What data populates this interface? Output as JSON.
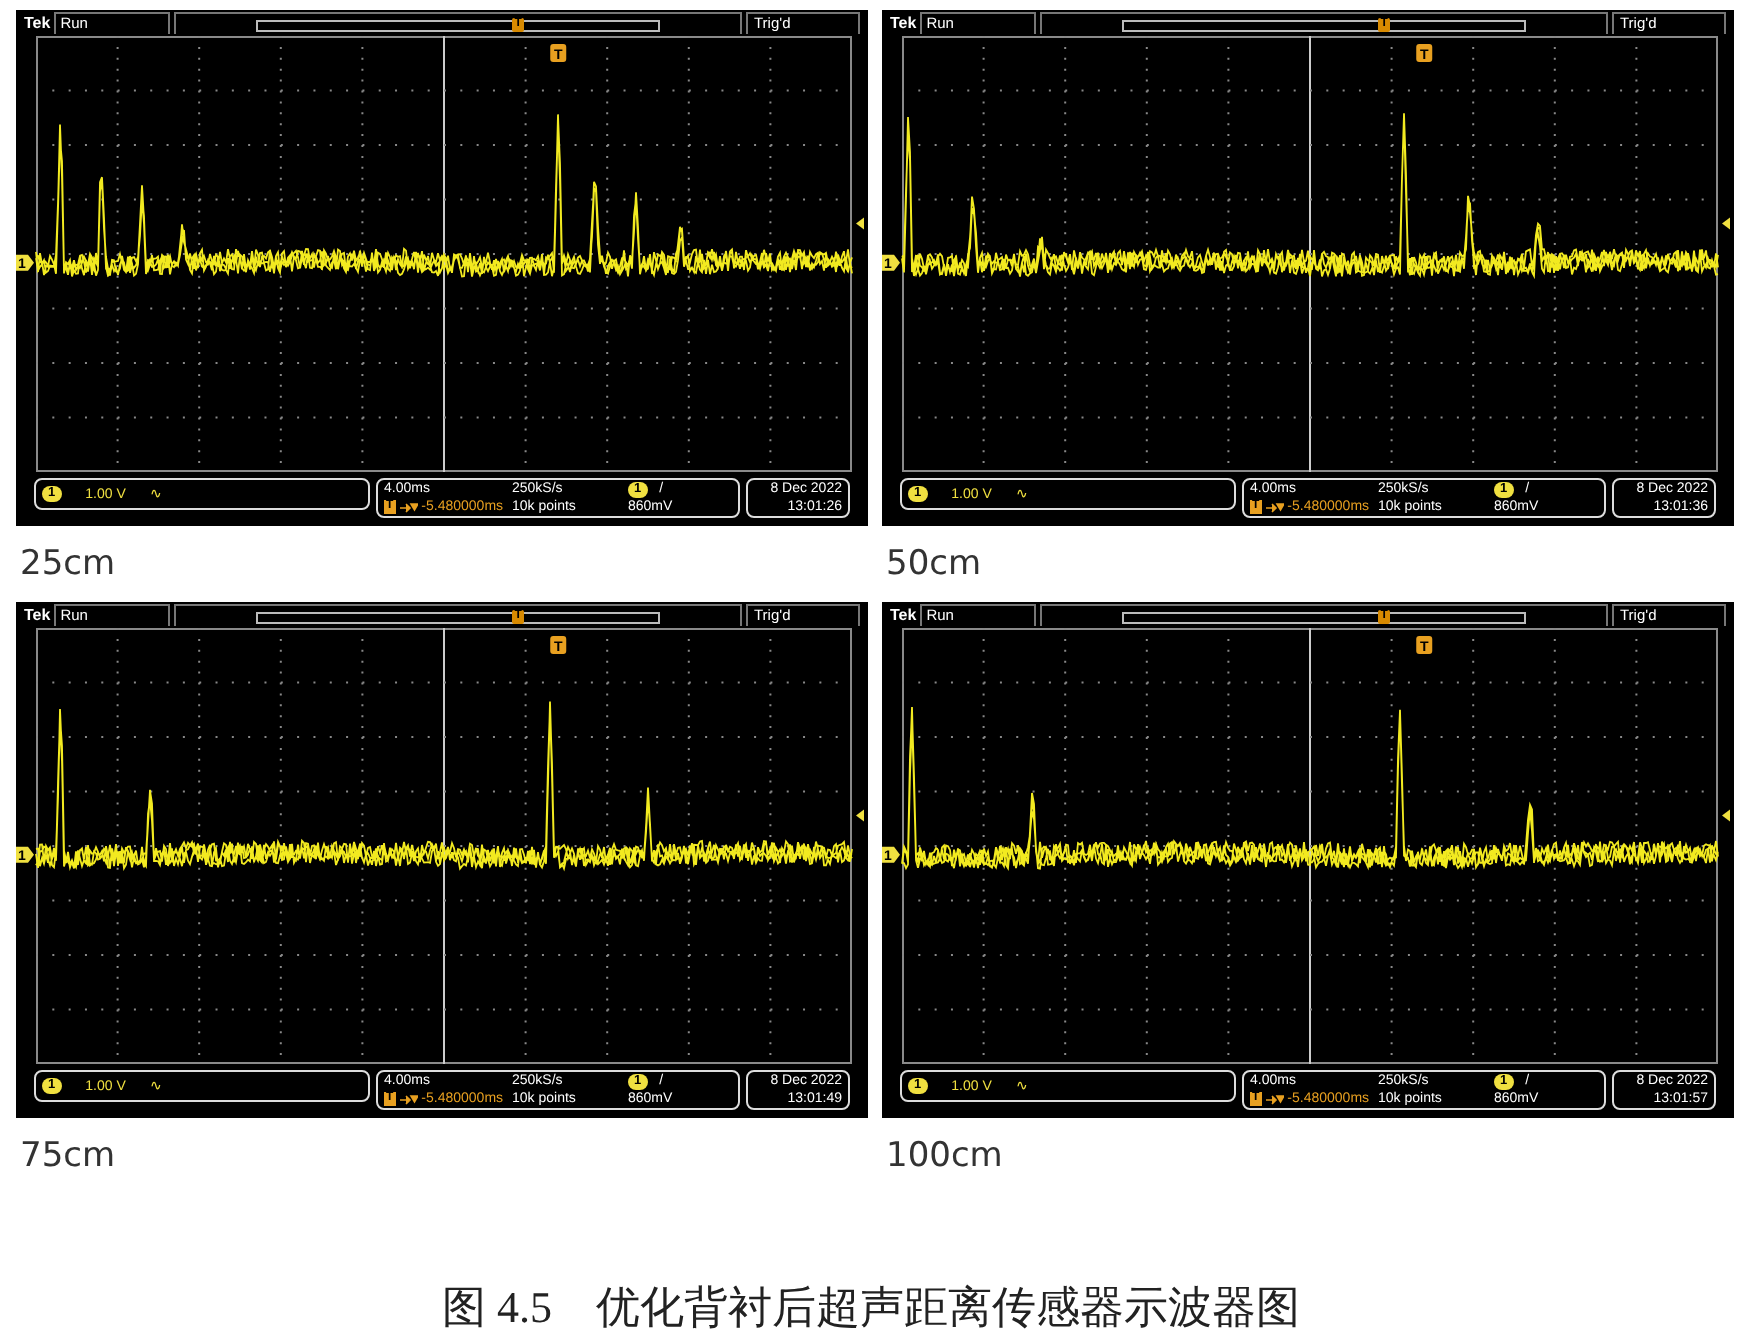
{
  "figure": {
    "panels": [
      {
        "label": "25cm",
        "scope": {
          "brand": "Tek",
          "run_state": "Run",
          "trigger_state": "Trig'd",
          "trigger_marker": "T",
          "channel_marker": "1",
          "channel": {
            "number": "1",
            "scale": "1.00 V",
            "coupling": "∿"
          },
          "timebase": {
            "scale": "4.00ms",
            "sample_rate": "250kS/s",
            "trigger_badge": "T",
            "delay": "-5.480000ms",
            "record_length": "10k points"
          },
          "trigger": {
            "source": "1",
            "slope": "/",
            "threshold": "860mV"
          },
          "date": "8 Dec 2022",
          "time": "13:01:26",
          "record_marker": "T"
        }
      },
      {
        "label": "50cm",
        "scope": {
          "brand": "Tek",
          "run_state": "Run",
          "trigger_state": "Trig'd",
          "trigger_marker": "T",
          "channel_marker": "1",
          "channel": {
            "number": "1",
            "scale": "1.00 V",
            "coupling": "∿"
          },
          "timebase": {
            "scale": "4.00ms",
            "sample_rate": "250kS/s",
            "trigger_badge": "T",
            "delay": "-5.480000ms",
            "record_length": "10k points"
          },
          "trigger": {
            "source": "1",
            "slope": "/",
            "threshold": "860mV"
          },
          "date": "8 Dec 2022",
          "time": "13:01:36",
          "record_marker": "T"
        }
      },
      {
        "label": "75cm",
        "scope": {
          "brand": "Tek",
          "run_state": "Run",
          "trigger_state": "Trig'd",
          "trigger_marker": "T",
          "channel_marker": "1",
          "channel": {
            "number": "1",
            "scale": "1.00 V",
            "coupling": "∿"
          },
          "timebase": {
            "scale": "4.00ms",
            "sample_rate": "250kS/s",
            "trigger_badge": "T",
            "delay": "-5.480000ms",
            "record_length": "10k points"
          },
          "trigger": {
            "source": "1",
            "slope": "/",
            "threshold": "860mV"
          },
          "date": "8 Dec 2022",
          "time": "13:01:49",
          "record_marker": "T"
        }
      },
      {
        "label": "100cm",
        "scope": {
          "brand": "Tek",
          "run_state": "Run",
          "trigger_state": "Trig'd",
          "trigger_marker": "T",
          "channel_marker": "1",
          "channel": {
            "number": "1",
            "scale": "1.00 V",
            "coupling": "∿"
          },
          "timebase": {
            "scale": "4.00ms",
            "sample_rate": "250kS/s",
            "trigger_badge": "T",
            "delay": "-5.480000ms",
            "record_length": "10k points"
          },
          "trigger": {
            "source": "1",
            "slope": "/",
            "threshold": "860mV"
          },
          "date": "8 Dec 2022",
          "time": "13:01:57",
          "record_marker": "T"
        }
      }
    ],
    "caption": {
      "number": "图 4.5",
      "title": "优化背衬后超声距离传感器示波器图"
    }
  }
}
